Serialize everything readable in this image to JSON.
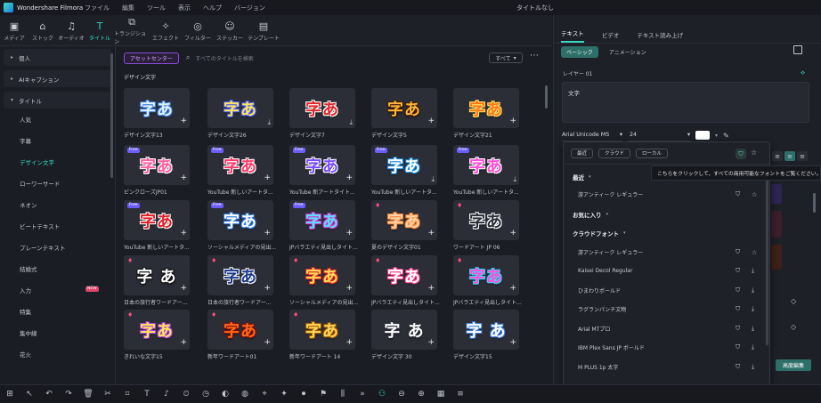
{
  "app": {
    "name": "Wondershare Filmora",
    "window_title": "タイトルなし",
    "menu": [
      "ファイル",
      "編集",
      "ツール",
      "表示",
      "ヘルプ",
      "バージョン"
    ]
  },
  "toolbar": [
    {
      "label": "メディア",
      "icon": "media-icon"
    },
    {
      "label": "ストック",
      "icon": "stock-icon"
    },
    {
      "label": "オーディオ",
      "icon": "music-icon"
    },
    {
      "label": "タイトル",
      "icon": "title-icon",
      "active": true
    },
    {
      "label": "トランジション",
      "icon": "transition-icon"
    },
    {
      "label": "エフェクト",
      "icon": "effect-icon"
    },
    {
      "label": "フィルター",
      "icon": "filter-icon"
    },
    {
      "label": "ステッカー",
      "icon": "sticker-icon"
    },
    {
      "label": "テンプレート",
      "icon": "template-icon"
    }
  ],
  "sidebar": {
    "groups": [
      {
        "label": "個人"
      },
      {
        "label": "AIキャプション"
      },
      {
        "label": "タイトル"
      }
    ],
    "items": [
      {
        "label": "人気"
      },
      {
        "label": "字幕"
      },
      {
        "label": "デザイン文字",
        "active": true
      },
      {
        "label": "ローワーサード"
      },
      {
        "label": "ネオン"
      },
      {
        "label": "ビートテキスト"
      },
      {
        "label": "プレーンテキスト"
      },
      {
        "label": "結婚式"
      },
      {
        "label": "入力",
        "badge": "NEW"
      },
      {
        "label": "特集"
      },
      {
        "label": "集中線"
      },
      {
        "label": "花火"
      }
    ]
  },
  "assets": {
    "center_button": "アセットセンター",
    "search_placeholder": "すべてのタイトルを検索",
    "filter_label": "すべて",
    "section_title": "デザイン文字"
  },
  "cards": [
    {
      "caption": "デザイン文字13",
      "glyph": "字あ",
      "style": "blue",
      "corner": "plus",
      "tag": ""
    },
    {
      "caption": "デザイン文字26",
      "glyph": "字あ",
      "style": "yellow",
      "corner": "download",
      "tag": ""
    },
    {
      "caption": "デザイン文字7",
      "glyph": "字あ",
      "style": "red",
      "corner": "download",
      "tag": ""
    },
    {
      "caption": "デザイン文字5",
      "glyph": "字あ",
      "style": "orange",
      "corner": "plus",
      "tag": ""
    },
    {
      "caption": "デザイン文字21",
      "glyph": "字あ",
      "style": "gold",
      "corner": "plus",
      "tag": ""
    },
    {
      "caption": "ピンクローズJP01",
      "glyph": "字あ",
      "style": "pink",
      "corner": "plus",
      "tag": "Free"
    },
    {
      "caption": "YouTube 新しいアートタ...",
      "glyph": "字あ",
      "style": "pinkred",
      "corner": "plus",
      "tag": "Free"
    },
    {
      "caption": "YouTube 新アートタイト...",
      "glyph": "字あ",
      "style": "purple",
      "corner": "plus",
      "tag": "Free"
    },
    {
      "caption": "YouTube 新しいアートタ...",
      "glyph": "字あ",
      "style": "white",
      "corner": "download",
      "tag": "Free"
    },
    {
      "caption": "YouTube 新しいアートタ...",
      "glyph": "字あ",
      "style": "magenta",
      "corner": "download",
      "tag": "Free"
    },
    {
      "caption": "YouTube 新しいアートタ...",
      "glyph": "字あ",
      "style": "crimson",
      "corner": "plus",
      "tag": "Free"
    },
    {
      "caption": "ソーシャルメディアの見出...",
      "glyph": "字あ",
      "style": "blue2",
      "corner": "plus",
      "tag": "Free"
    },
    {
      "caption": "JPバラエティ見出しタイト...",
      "glyph": "字あ",
      "style": "cyan",
      "corner": "plus",
      "tag": "Free"
    },
    {
      "caption": "夏のデザイン文字01",
      "glyph": "字あ",
      "style": "peach",
      "corner": "plus",
      "tag": "gem"
    },
    {
      "caption": "ワードアート JP 06",
      "glyph": "字あ",
      "style": "outline",
      "corner": "plus",
      "tag": "gem"
    },
    {
      "caption": "日本の旅行者ワードアー...",
      "glyph": "字 あ",
      "style": "white2",
      "corner": "plus",
      "tag": "gem"
    },
    {
      "caption": "日本の旅行者ワードアー...",
      "glyph": "字あ",
      "style": "navy",
      "corner": "plus",
      "tag": "gem"
    },
    {
      "caption": "ソーシャルメディアの見出...",
      "glyph": "字あ",
      "style": "redgrad",
      "corner": "plus",
      "tag": "gem"
    },
    {
      "caption": "JPバラエティ見出しタイト...",
      "glyph": "字あ",
      "style": "pinkwhite",
      "corner": "plus",
      "tag": "gem"
    },
    {
      "caption": "JPバラエティ見出しタイト...",
      "glyph": "字あ",
      "style": "rainbow",
      "corner": "plus",
      "tag": "gem"
    },
    {
      "caption": "きれいな文字15",
      "glyph": "字あ",
      "style": "candy",
      "corner": "plus",
      "tag": "gem"
    },
    {
      "caption": "新年ワードアート01",
      "glyph": "字あ",
      "style": "fire",
      "corner": "plus",
      "tag": "gem"
    },
    {
      "caption": "新年ワードアート 14",
      "glyph": "字あ",
      "style": "goldglow",
      "corner": "plus",
      "tag": "gem"
    },
    {
      "caption": "デザイン文字 30",
      "glyph": "字 あ",
      "style": "plainwhite",
      "corner": "plus",
      "tag": ""
    },
    {
      "caption": "デザイン文字15",
      "glyph": "字 あ",
      "style": "lightblue",
      "corner": "plus",
      "tag": ""
    }
  ],
  "right_panel": {
    "tabs": [
      "テキスト",
      "ビデオ",
      "テキスト読み上げ"
    ],
    "subtabs": [
      "ベーシック",
      "アニメーション"
    ],
    "layer_label": "レイヤー 01",
    "text_value": "文字",
    "font_value": "Arial Unicode MS",
    "size_value": "24",
    "color_value": "#ffffff",
    "advanced_button": "高度編集"
  },
  "font_dropdown": {
    "filters": [
      "最近",
      "クラウド",
      "ローカル"
    ],
    "tooltip": "こちらをクリックして、すべての商用可能なフォントをご覧ください。",
    "rows": [
      {
        "type": "head",
        "label": "最近",
        "caret": true
      },
      {
        "type": "font",
        "label": "游アンティーク レギュラー",
        "action": "star"
      },
      {
        "type": "head",
        "label": "お気に入り",
        "caret": true
      },
      {
        "type": "head",
        "label": "クラウドフォント",
        "caret": true
      },
      {
        "type": "font",
        "label": "游アンティーク レギュラー",
        "action": "star"
      },
      {
        "type": "font",
        "label": "Kaisei Decol Regular",
        "action": "download"
      },
      {
        "type": "font",
        "label": "ひまわりボールド",
        "action": "download"
      },
      {
        "type": "font",
        "label": "ラグランパンチ文物",
        "action": "download"
      },
      {
        "type": "font",
        "label": "Arial MTプロ",
        "action": "download"
      },
      {
        "type": "font",
        "label": "IBM Plex Sans JP ボールド",
        "action": "download"
      },
      {
        "type": "font",
        "label": "M PLUS 1p 太字",
        "action": "download"
      }
    ]
  },
  "bottombar_icons": [
    "grid-icon",
    "select-icon",
    "undo-icon",
    "redo-icon",
    "delete-icon",
    "cut-icon",
    "crop-icon",
    "text-icon",
    "audio-icon",
    "speed-icon",
    "timer-icon",
    "mask-icon",
    "color-icon",
    "stabilize-icon",
    "ai-icon",
    "record-icon",
    "marker-icon",
    "split-icon",
    "more-icon",
    "snap-icon",
    "zoom-out-icon",
    "zoom-in-icon",
    "layout-icon",
    "settings-icon"
  ]
}
